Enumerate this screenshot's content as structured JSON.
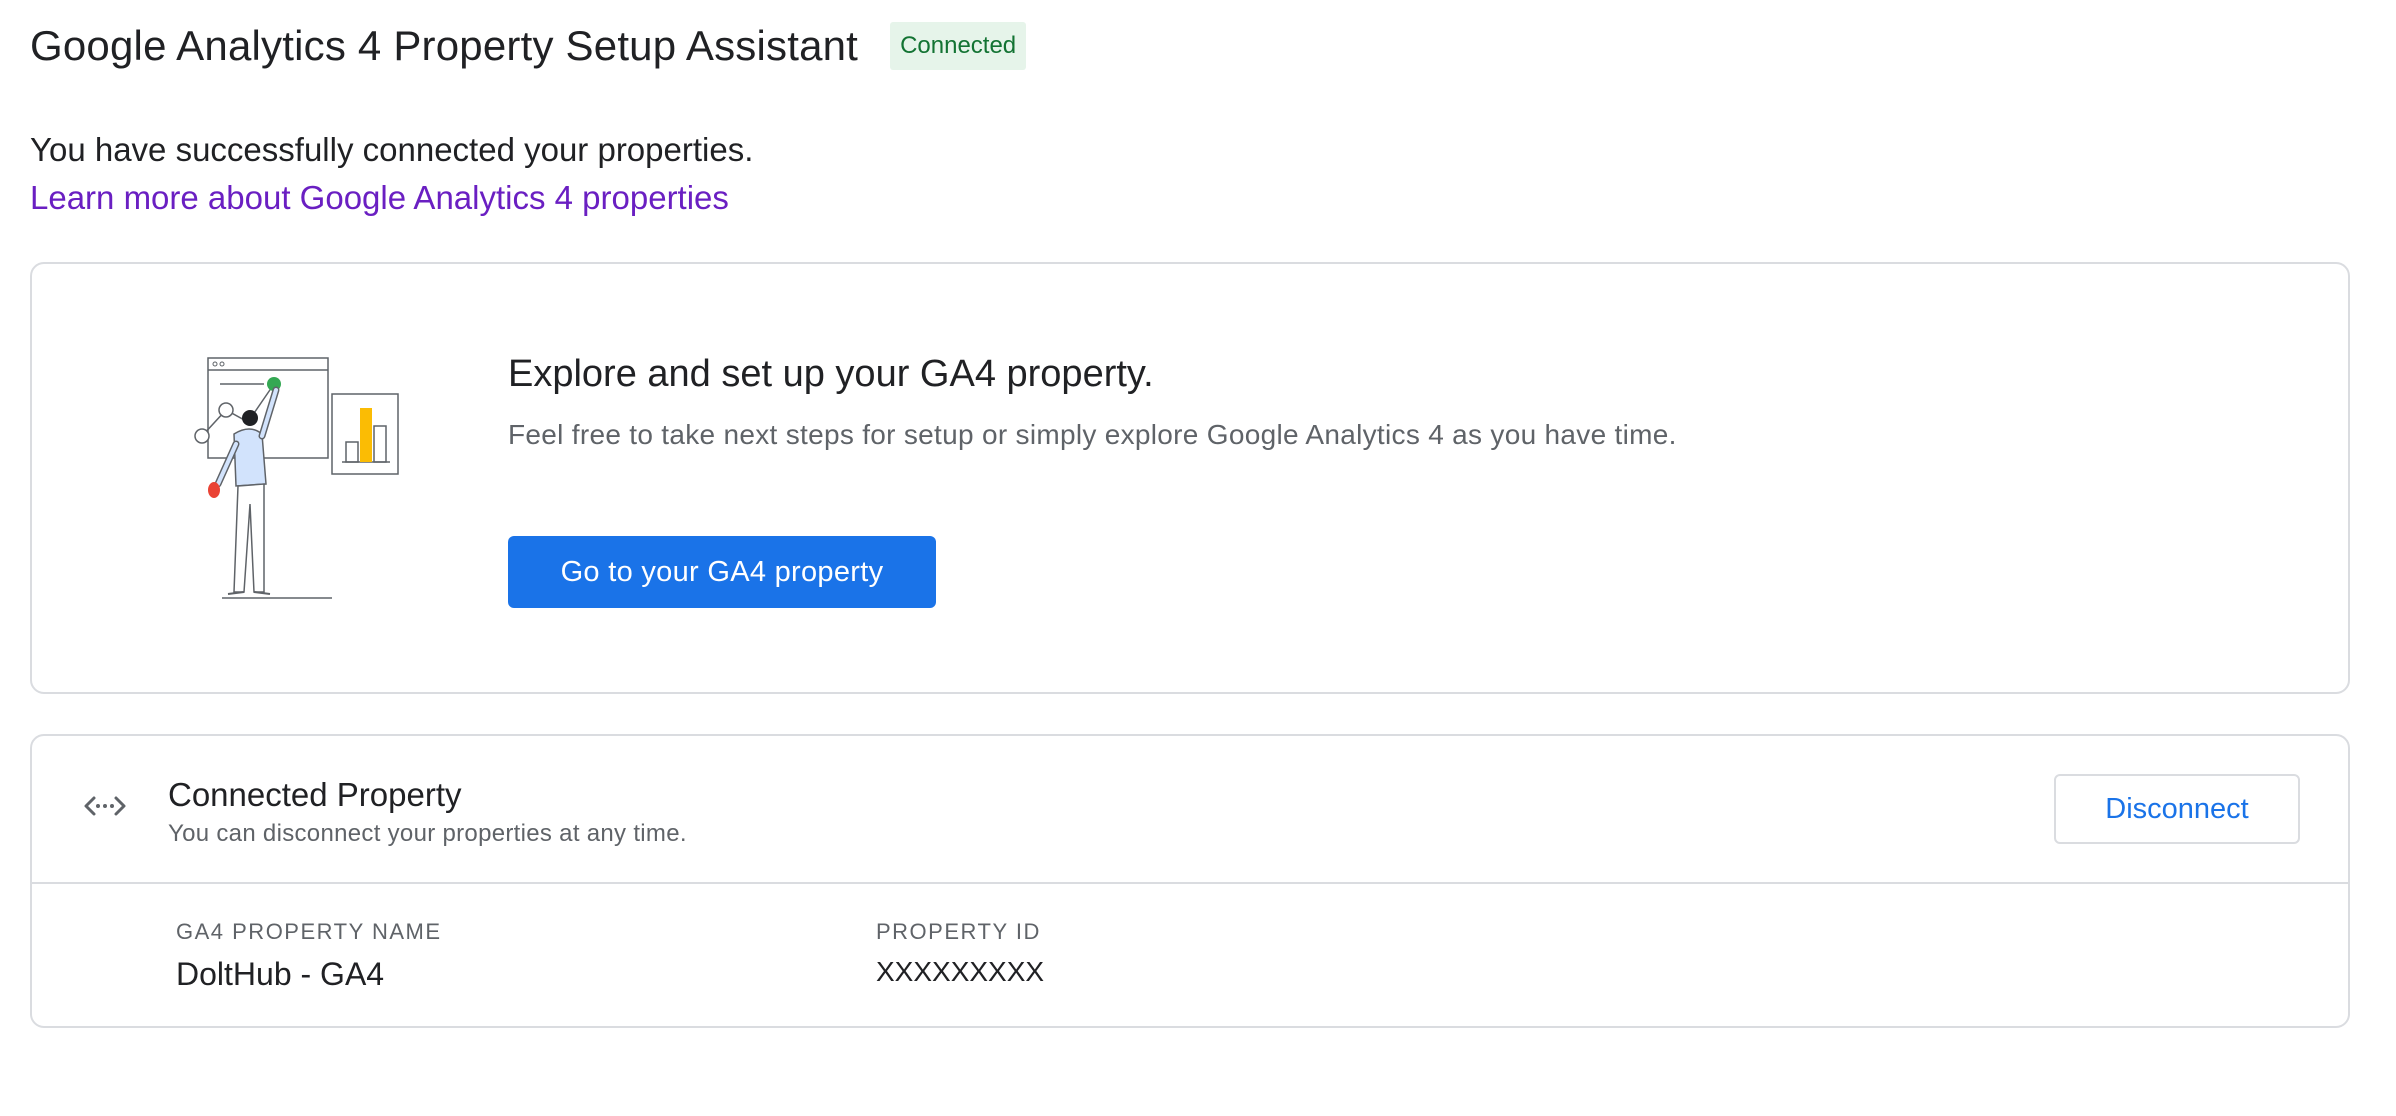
{
  "header": {
    "title": "Google Analytics 4 Property Setup Assistant",
    "status_badge": "Connected"
  },
  "intro": {
    "message": "You have successfully connected your properties.",
    "learn_more_link": "Learn more about Google Analytics 4 properties"
  },
  "explore_card": {
    "title": "Explore and set up your GA4 property.",
    "description": "Feel free to take next steps for setup or simply explore Google Analytics 4 as you have time.",
    "button_label": "Go to your GA4 property",
    "illustration_icon": "analytics-presenter-illustration"
  },
  "connected_card": {
    "icon": "link-arrows-icon",
    "title": "Connected Property",
    "subtitle": "You can disconnect your properties at any time.",
    "disconnect_label": "Disconnect",
    "fields": [
      {
        "label": "GA4 PROPERTY NAME",
        "value": "DoltHub - GA4"
      },
      {
        "label": "PROPERTY ID",
        "value": "XXXXXXXXX"
      }
    ]
  },
  "colors": {
    "primary": "#1a73e8",
    "link_visited": "#6a1fc2",
    "badge_bg": "#e6f4ea",
    "badge_text": "#137333",
    "border": "#dadce0"
  }
}
